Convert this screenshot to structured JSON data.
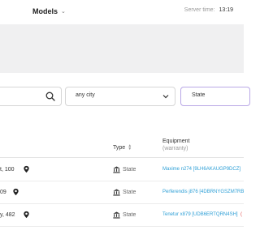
{
  "header": {
    "section_label": "Models",
    "server_time_label": "Server time:",
    "server_time_value": "13:19"
  },
  "filters": {
    "search_value": "",
    "city_value": "any city",
    "state_value": "State"
  },
  "table": {
    "columns": {
      "type": "Type",
      "equipment": "Equipment",
      "equipment_sub": "(warranty)"
    },
    "rows": [
      {
        "address": "t, 100",
        "type": "State",
        "equipment": "Maxime n274 [9LH6AKAUGP9DCZ]",
        "trailing": ""
      },
      {
        "address": "09",
        "type": "State",
        "equipment": "Perferendis j876 [4DBRNYGSZM7RB",
        "trailing": ""
      },
      {
        "address": "y, 482",
        "type": "State",
        "equipment": "Tenetur x879 [UDB6ERTQRN4SH]",
        "trailing": "("
      }
    ]
  },
  "colors": {
    "link": "#2e9fd6",
    "accent_border": "#b9a8e6",
    "grey_band": "#f0f0f1"
  }
}
